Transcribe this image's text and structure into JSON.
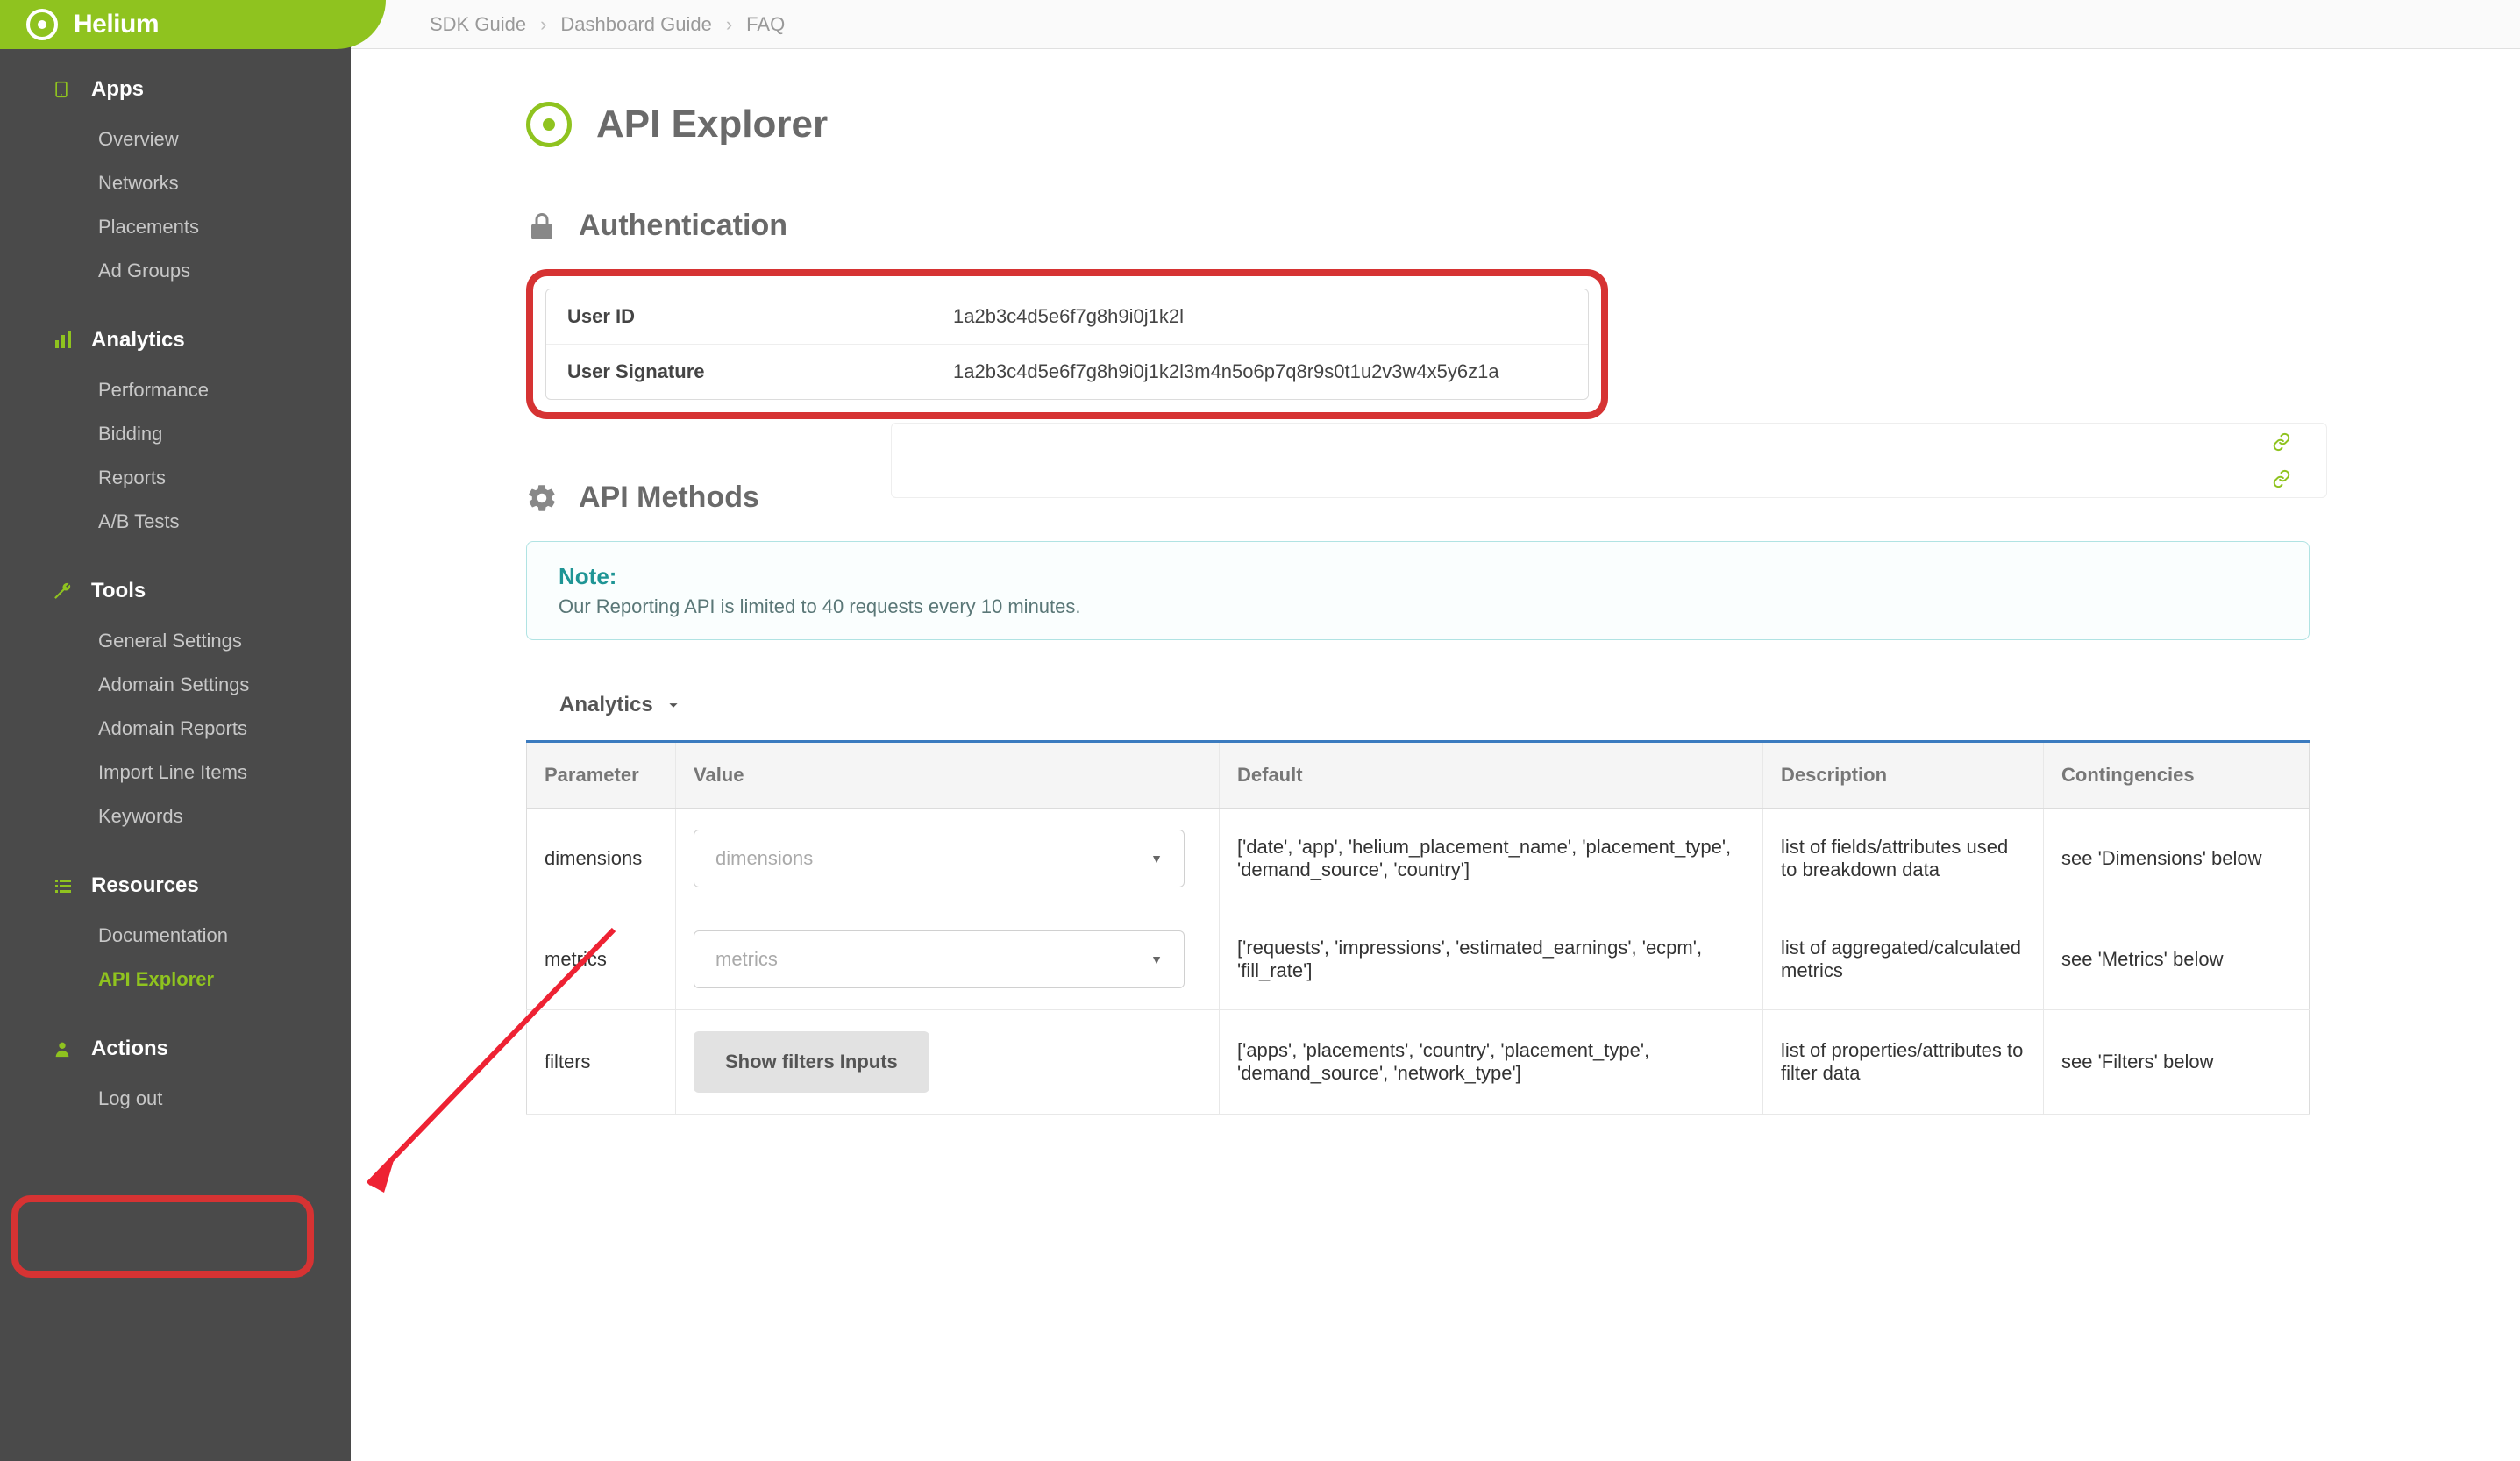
{
  "brand": "Helium",
  "breadcrumbs": [
    "SDK Guide",
    "Dashboard Guide",
    "FAQ"
  ],
  "sidebar": {
    "sections": [
      {
        "title": "Apps",
        "items": [
          "Overview",
          "Networks",
          "Placements",
          "Ad Groups"
        ]
      },
      {
        "title": "Analytics",
        "items": [
          "Performance",
          "Bidding",
          "Reports",
          "A/B Tests"
        ]
      },
      {
        "title": "Tools",
        "items": [
          "General Settings",
          "Adomain Settings",
          "Adomain Reports",
          "Import Line Items",
          "Keywords"
        ]
      },
      {
        "title": "Resources",
        "items": [
          "Documentation",
          "API Explorer"
        ]
      },
      {
        "title": "Actions",
        "items": [
          "Log out"
        ]
      }
    ],
    "active": "API Explorer"
  },
  "page_title": "API Explorer",
  "auth": {
    "heading": "Authentication",
    "rows": [
      {
        "label": "User ID",
        "value": "1a2b3c4d5e6f7g8h9i0j1k2l"
      },
      {
        "label": "User Signature",
        "value": "1a2b3c4d5e6f7g8h9i0j1k2l3m4n5o6p7q8r9s0t1u2v3w4x5y6z1a"
      }
    ]
  },
  "methods": {
    "heading": "API Methods",
    "note_title": "Note:",
    "note_body": "Our Reporting API is limited to 40 requests every 10 minutes.",
    "group": "Analytics",
    "columns": [
      "Parameter",
      "Value",
      "Default",
      "Description",
      "Contingencies"
    ],
    "rows": [
      {
        "param": "dimensions",
        "value_placeholder": "dimensions",
        "default": "['date', 'app', 'helium_placement_name', 'placement_type', 'demand_source', 'country']",
        "desc": "list of fields/attributes used to breakdown data",
        "cont": "see 'Dimensions' below"
      },
      {
        "param": "metrics",
        "value_placeholder": "metrics",
        "default": "['requests', 'impressions', 'estimated_earnings', 'ecpm', 'fill_rate']",
        "desc": "list of aggregated/calculated metrics",
        "cont": "see 'Metrics' below"
      },
      {
        "param": "filters",
        "value_button": "Show filters Inputs",
        "default": "['apps', 'placements', 'country', 'placement_type', 'demand_source', 'network_type']",
        "desc": "list of properties/attributes to filter data",
        "cont": "see 'Filters' below"
      }
    ]
  }
}
